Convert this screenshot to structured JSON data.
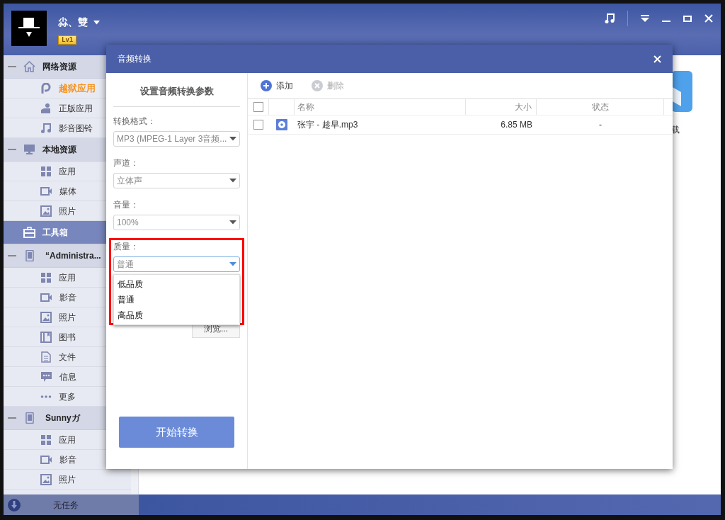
{
  "header": {
    "user_name": "尛、雙",
    "level_badge": "Lv1"
  },
  "sidebar": {
    "groups": [
      {
        "label": "网络资源",
        "kind": "section",
        "selected": false,
        "items": [
          {
            "label": "越狱应用",
            "selected": true
          },
          {
            "label": "正版应用",
            "selected": false
          },
          {
            "label": "影音图铃",
            "selected": false
          }
        ]
      },
      {
        "label": "本地资源",
        "kind": "section",
        "selected": false,
        "items": [
          {
            "label": "应用",
            "selected": false
          },
          {
            "label": "媒体",
            "selected": false
          },
          {
            "label": "照片",
            "selected": false
          }
        ]
      },
      {
        "label": "工具箱",
        "kind": "tool",
        "selected": true
      },
      {
        "label": "“Administra...",
        "kind": "device",
        "selected": false,
        "items": [
          {
            "label": "应用",
            "selected": false
          },
          {
            "label": "影音",
            "selected": false
          },
          {
            "label": "照片",
            "selected": false
          },
          {
            "label": "图书",
            "selected": false
          },
          {
            "label": "文件",
            "selected": false
          },
          {
            "label": "信息",
            "selected": false
          },
          {
            "label": "更多",
            "selected": false
          }
        ]
      },
      {
        "label": "Sunnyガ",
        "kind": "device",
        "selected": false,
        "items": [
          {
            "label": "应用",
            "selected": false
          },
          {
            "label": "影音",
            "selected": false
          },
          {
            "label": "照片",
            "selected": false
          }
        ]
      }
    ]
  },
  "background_content": {
    "label": "载"
  },
  "status_bar": {
    "text": "无任务"
  },
  "dialog": {
    "title": "音频转换",
    "settings": {
      "heading": "设置音频转换参数",
      "fields": [
        {
          "label": "转换格式：",
          "value": "MP3 (MPEG-1 Layer 3音频...",
          "open": false,
          "highlighted": false
        },
        {
          "label": "声道：",
          "value": "立体声",
          "open": false,
          "highlighted": false
        },
        {
          "label": "音量：",
          "value": "100%",
          "open": false,
          "highlighted": false
        },
        {
          "label": "质量：",
          "value": "普通",
          "open": true,
          "highlighted": true,
          "options": [
            "低品质",
            "普通",
            "高品质"
          ]
        }
      ],
      "browse_button": "浏览...",
      "start_button": "开始转换"
    },
    "toolbar": [
      {
        "label": "添加",
        "kind": "add",
        "disabled": false
      },
      {
        "label": "删除",
        "kind": "delete",
        "disabled": true
      }
    ],
    "table": {
      "columns": [
        "名称",
        "大小",
        "状态"
      ],
      "all_checked": false,
      "rows": [
        {
          "name": "张宇 - 趁早.mp3",
          "size": "6.85 MB",
          "status": "-",
          "checked": false
        }
      ]
    }
  }
}
